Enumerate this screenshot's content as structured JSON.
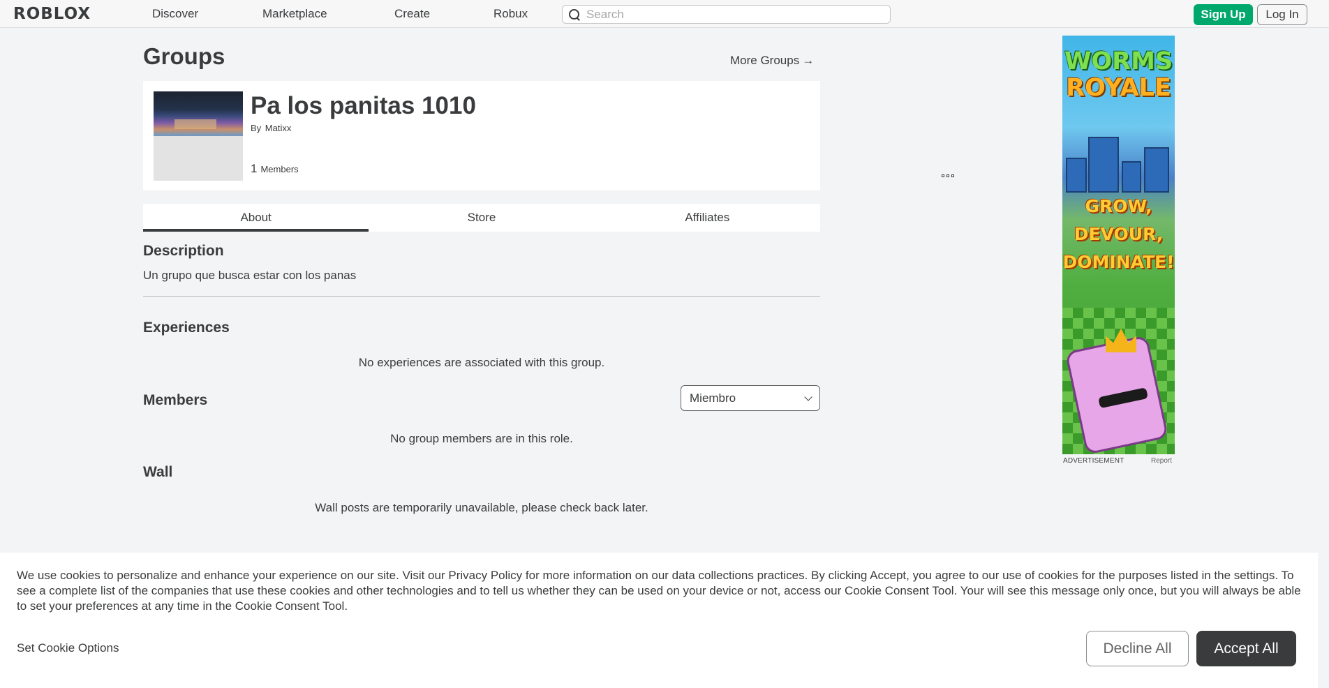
{
  "nav": {
    "logo": "ROBLOX",
    "links": [
      "Discover",
      "Marketplace",
      "Create",
      "Robux"
    ],
    "search_placeholder": "Search",
    "signup": "Sign Up",
    "login": "Log In"
  },
  "page": {
    "title": "Groups",
    "more_groups": "More Groups",
    "more_groups_arrow": "→"
  },
  "group": {
    "name": "Pa los panitas 1010",
    "by_label": "By",
    "owner": "Matixx",
    "member_count": "1",
    "members_label": "Members"
  },
  "tabs": [
    "About",
    "Store",
    "Affiliates"
  ],
  "about": {
    "description_title": "Description",
    "description_text": "Un grupo que busca estar con los panas",
    "experiences_title": "Experiences",
    "experiences_empty": "No experiences are associated with this group.",
    "members_title": "Members",
    "role_selected": "Miembro",
    "members_empty": "No group members are in this role.",
    "wall_title": "Wall",
    "wall_empty": "Wall posts are temporarily unavailable, please check back later."
  },
  "ad": {
    "title_line1": "WORMS",
    "title_line2": "ROYALE",
    "slogan": [
      "GROW,",
      "DEVOUR,",
      "DOMINATE!"
    ],
    "label": "ADVERTISEMENT",
    "report": "Report"
  },
  "cookie": {
    "text_before": "We use cookies to personalize and enhance your experience on our site. Visit our",
    "privacy_link": "Privacy Policy",
    "text_after": "for more information on our data collections practices. By clicking Accept, you agree to our use of cookies for the purposes listed in the settings. To see a complete list of the companies that use these cookies and other technologies and to tell us whether they can be used on your device or not, access our Cookie Consent Tool. Your will see this message only once, but you will always be able to set your preferences at any time in the Cookie Consent Tool.",
    "set_options": "Set Cookie Options",
    "decline": "Decline All",
    "accept": "Accept All"
  },
  "colors": {
    "signup_green": "#00a86b",
    "text_dark": "#393b3d",
    "page_bg": "#f2f4f5"
  }
}
